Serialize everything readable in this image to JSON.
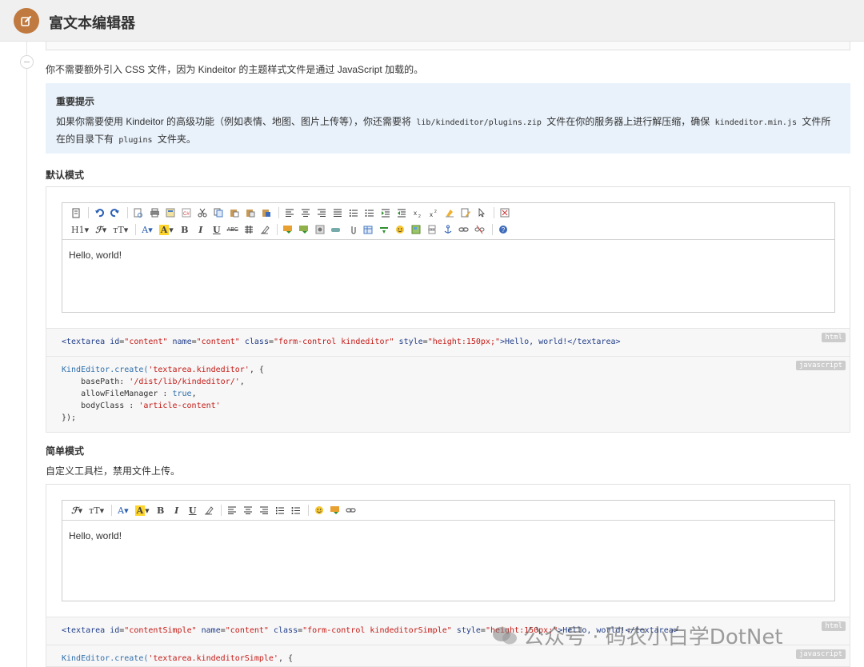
{
  "header": {
    "title": "富文本编辑器"
  },
  "intro": "你不需要额外引入 CSS 文件，因为 Kindeitor 的主题样式文件是通过 JavaScript 加载的。",
  "alert": {
    "title": "重要提示",
    "text_a": "如果你需要使用 Kindeitor 的高级功能（例如表情、地图、图片上传等），你还需要将",
    "code_a": "lib/kindeditor/plugins.zip",
    "text_b": "文件在你的服务器上进行解压缩，确保",
    "code_b": "kindeditor.min.js",
    "text_c": "文件所在的目录下有",
    "code_c": "plugins",
    "text_d": "文件夹。"
  },
  "default_mode": {
    "title": "默认模式",
    "content": "Hello, world!",
    "toolbar_row2_labels": {
      "h1": "H1▾",
      "font": "ℱ▾",
      "size": "тT▾",
      "forecolor": "A▾",
      "hilite": "A",
      "bold": "B",
      "italic": "I",
      "underline": "U",
      "strike": "ABC"
    },
    "html_tag": "html",
    "html_code": {
      "p1": "<textarea ",
      "a1": "id",
      "e1": "=",
      "v1": "\"content\"",
      "s1": " ",
      "a2": "name",
      "v2": "\"content\"",
      "a3": "class",
      "v3": "\"form-control kindeditor\"",
      "a4": "style",
      "v4": "\"height:150px;\"",
      "p2": ">Hello, world!</textarea>"
    },
    "js_tag": "javascript",
    "js_code": {
      "l1_fn": "KindEditor.create(",
      "l1_str": "'textarea.kindeditor'",
      "l1_end": ", {",
      "l2_key": "    basePath: ",
      "l2_str": "'/dist/lib/kindeditor/'",
      "l2_end": ",",
      "l3_key": "    allowFileManager : ",
      "l3_kw": "true",
      "l3_end": ",",
      "l4_key": "    bodyClass : ",
      "l4_str": "'article-content'",
      "l5": "});"
    }
  },
  "simple_mode": {
    "title": "简单模式",
    "desc": "自定义工具栏，禁用文件上传。",
    "content": "Hello, world!",
    "toolbar_labels": {
      "font": "ℱ▾",
      "size": "тT▾",
      "forecolor": "A▾",
      "hilite": "A",
      "bold": "B",
      "italic": "I",
      "underline": "U"
    },
    "html_tag": "html",
    "html_code": {
      "p1": "<textarea ",
      "a1": "id",
      "v1": "\"contentSimple\"",
      "a2": "name",
      "v2": "\"content\"",
      "a3": "class",
      "v3": "\"form-control kindeditorSimple\"",
      "a4": "style",
      "v4": "\"height:150px;\"",
      "p2": ">Hello, world!</textarea>"
    },
    "js_tag": "javascript",
    "js_code": {
      "l1_fn": "KindEditor.create(",
      "l1_str": "'textarea.kindeditorSimple'",
      "l1_end": ", {"
    }
  },
  "watermark": "公众号 · 码农小白学DotNet",
  "colors": {
    "badge": "#c0793e",
    "alert_bg": "#e9f2fb",
    "code_bg": "#f7f7f7",
    "code_string": "#c41a16",
    "code_attr": "#1f3c88"
  }
}
